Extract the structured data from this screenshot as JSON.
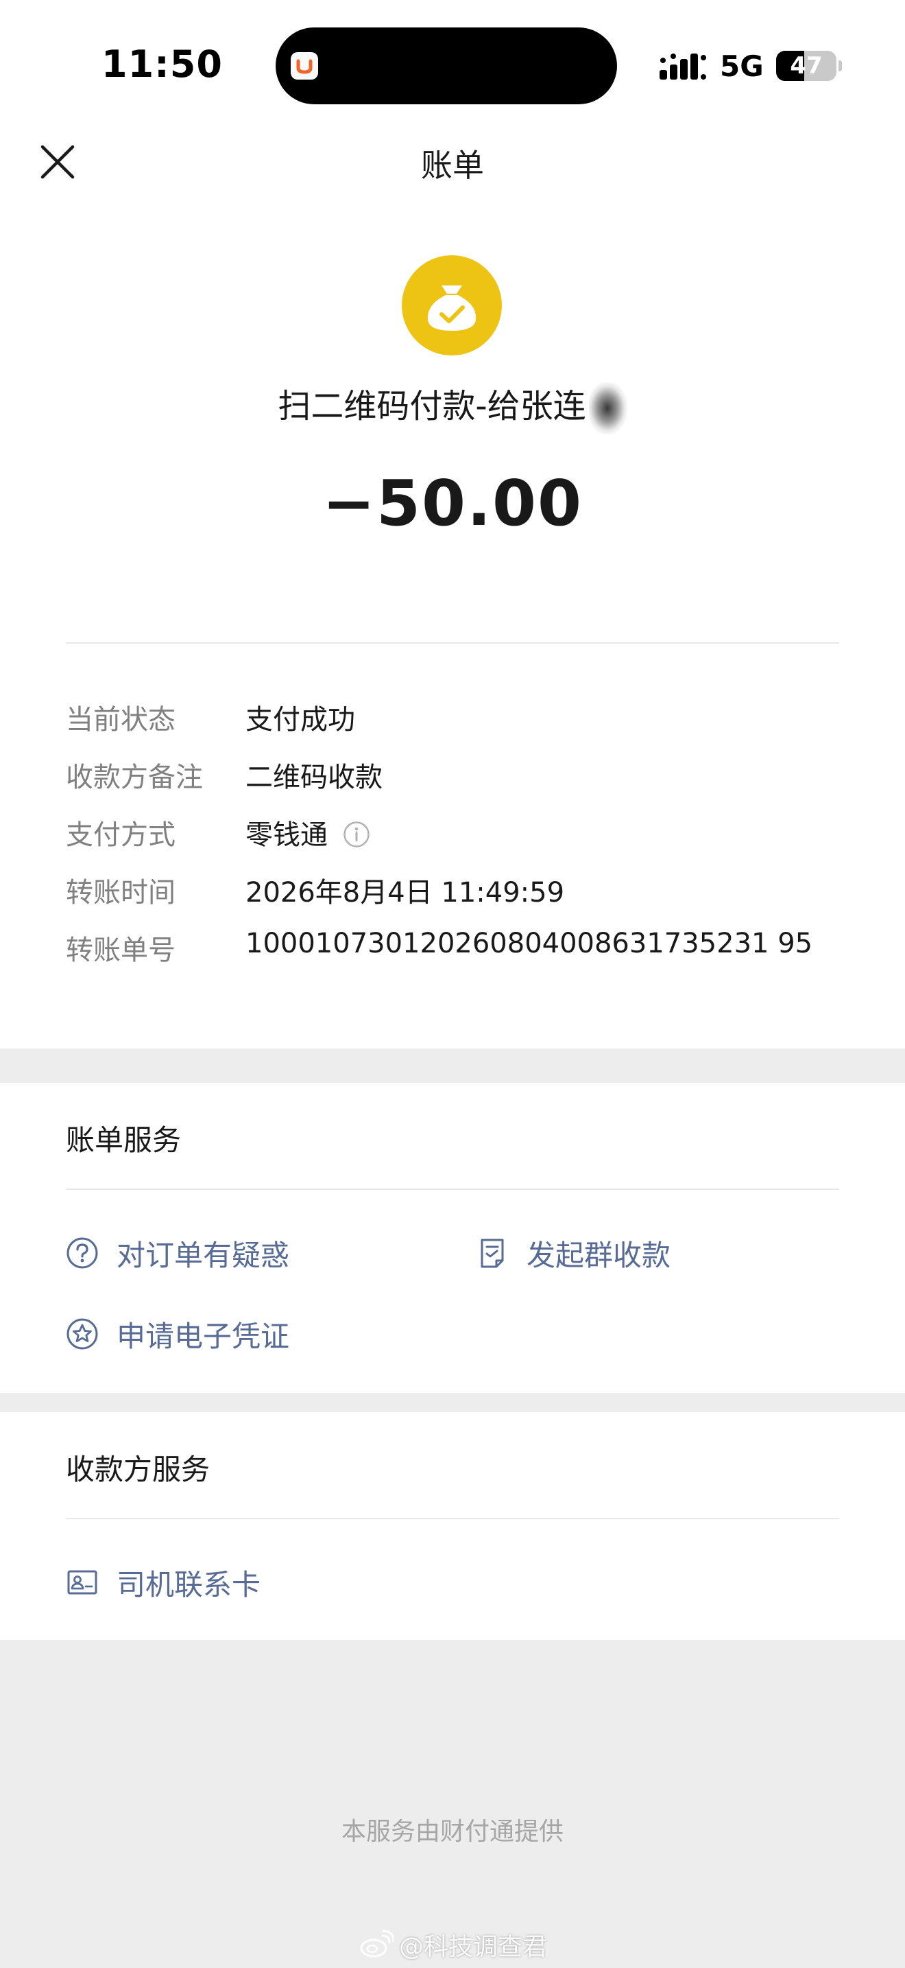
{
  "status_bar": {
    "time": "11:50",
    "network": "5G",
    "battery_level": "47",
    "battery_fraction": 0.47
  },
  "nav": {
    "title": "账单",
    "close_icon": "close-icon"
  },
  "summary": {
    "icon": "money-bag-check-icon",
    "payee": "扫二维码付款-给张连",
    "amount": "−50.00",
    "accent_color": "#edc314"
  },
  "details": [
    {
      "label": "当前状态",
      "value": "支付成功"
    },
    {
      "label": "收款方备注",
      "value": "二维码收款"
    },
    {
      "label": "支付方式",
      "value": "零钱通"
    },
    {
      "label": "转账时间",
      "value": "2026年8月4日 11:49:59"
    },
    {
      "label": "转账单号",
      "value": "100010730120260804008631735231 95"
    }
  ],
  "bill_services": {
    "title": "账单服务",
    "actions": [
      {
        "label": "对订单有疑惑",
        "icon": "question-circle-icon"
      },
      {
        "label": "发起群收款",
        "icon": "document-icon"
      },
      {
        "label": "申请电子凭证",
        "icon": "star-badge-icon"
      }
    ]
  },
  "payee_services": {
    "title": "收款方服务",
    "actions": [
      {
        "label": "司机联系卡",
        "icon": "contact-card-icon"
      }
    ]
  },
  "footer": {
    "provider_text": "本服务由财付通提供",
    "watermark": "@科技调查君"
  },
  "colors": {
    "link": "#576b95",
    "background": "#ededed"
  }
}
